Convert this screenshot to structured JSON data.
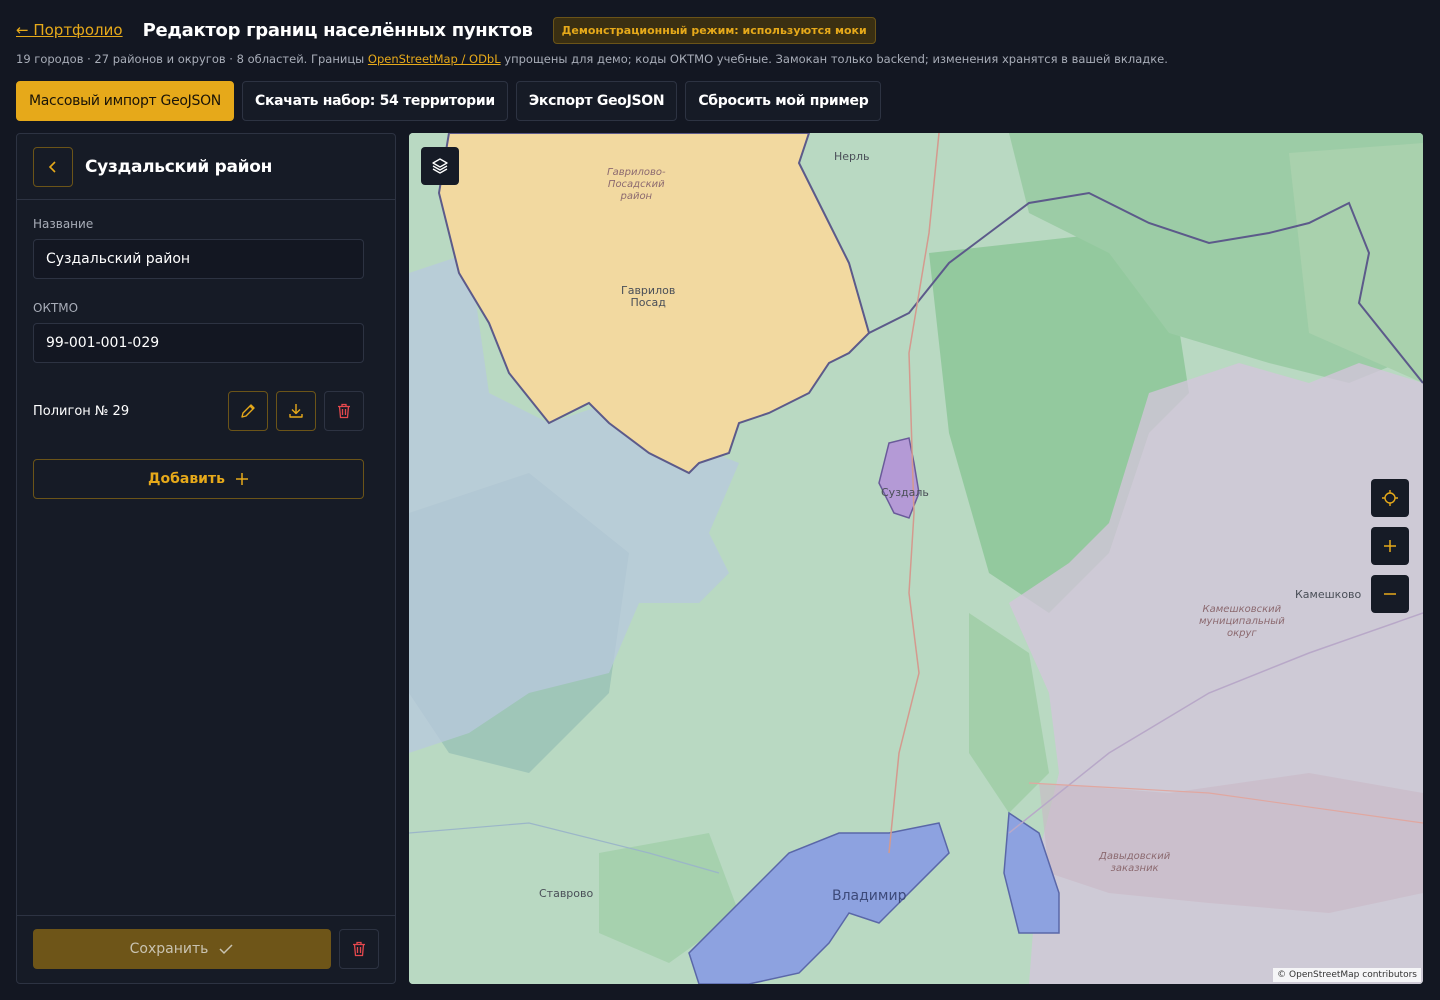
{
  "header": {
    "back_label": "← Портфолио",
    "title": "Редактор границ населённых пунктов",
    "demo_badge": "Демонстрационный режим: используются моки"
  },
  "subtitle": {
    "before_link": "19 городов · 27 районов и округов · 8 областей. Границы ",
    "link_text": "OpenStreetMap / ODbL",
    "after_link": " упрощены для демо; коды ОКТМО учебные. Замокан только backend; изменения хранятся в вашей вкладке."
  },
  "toolbar": {
    "import_label": "Массовый импорт GeoJSON",
    "download_label": "Скачать набор: 54 территории",
    "export_label": "Экспорт GeoJSON",
    "reset_label": "Сбросить мой пример"
  },
  "editor": {
    "back_icon": "chevron-left-icon",
    "title": "Суздальский район",
    "name_label": "Название",
    "name_value": "Суздальский район",
    "oktmo_label": "ОКТМО",
    "oktmo_value": "99-001-001-029",
    "polygon_label": "Полигон № 29",
    "add_label": "Добавить",
    "save_label": "Сохранить"
  },
  "map": {
    "labels": {
      "nerl": "Нерль",
      "gavrilov_district": "Гаврилово-\nПосадский\nрайон",
      "gavrilov_posad": "Гаврилов\nПосад",
      "suzdal": "Суздаль",
      "kameshkovo": "Камешково",
      "kameshkovo_district": "Камешковский\nмуниципальный\nокруг",
      "davydovsky": "Давыдовский\nзаказник",
      "stavrovo": "Ставрово",
      "vladimir": "Владимир"
    },
    "attribution": "© OpenStreetMap contributors",
    "colors": {
      "accent": "#e6a91a",
      "district_fill": "#f2d9a0",
      "selected_fill": "#b49ad6",
      "city_fill": "#8da2e0"
    }
  }
}
